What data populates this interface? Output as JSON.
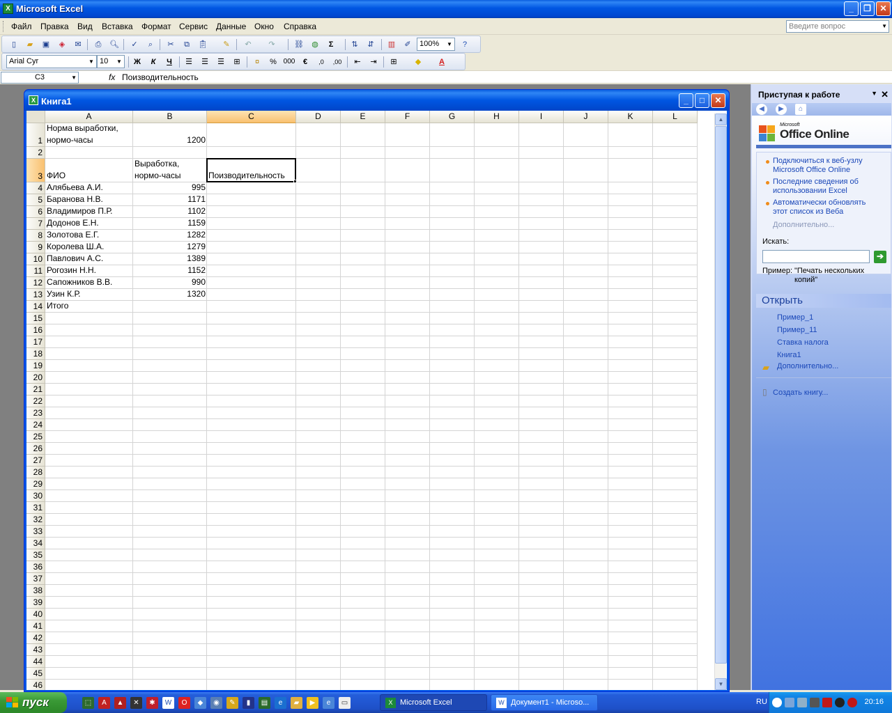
{
  "app": {
    "title": "Microsoft Excel",
    "help_placeholder": "Введите вопрос"
  },
  "menu": [
    "Файл",
    "Правка",
    "Вид",
    "Вставка",
    "Формат",
    "Сервис",
    "Данные",
    "Окно",
    "Справка"
  ],
  "toolbar": {
    "zoom": "100%",
    "font_name": "Arial Cyr",
    "font_size": "10",
    "bold": "Ж",
    "italic": "К",
    "underline": "Ч",
    "percent": "%",
    "thousands": "000",
    "euro": "€",
    "sum": "Σ"
  },
  "formula_bar": {
    "name_box": "C3",
    "fx": "fx",
    "content": "Поизводительность"
  },
  "workbook": {
    "title": "Книга1",
    "columns": [
      "A",
      "B",
      "C",
      "D",
      "E",
      "F",
      "G",
      "H",
      "I",
      "J",
      "K",
      "L"
    ],
    "selected_column": "C",
    "selected_row": "3",
    "rows": [
      "1",
      "2",
      "3",
      "4",
      "5",
      "6",
      "7",
      "8",
      "9",
      "10",
      "11",
      "12",
      "13",
      "14",
      "15",
      "16",
      "17",
      "18",
      "19",
      "20",
      "21",
      "22",
      "23",
      "24",
      "25",
      "26",
      "27",
      "28",
      "29",
      "30",
      "31",
      "32",
      "33",
      "34",
      "35",
      "36",
      "37",
      "38",
      "39",
      "40",
      "41",
      "42",
      "43",
      "44",
      "45",
      "46"
    ],
    "cells": {
      "A1": "Норма выработки, нормо-часы",
      "B1": "1200",
      "A3": "ФИО",
      "B3": "Выработка, нормо-часы",
      "C3": "Поизводительность",
      "A4": "Алябьева А.И.",
      "B4": "995",
      "A5": "Баранова Н.В.",
      "B5": "1171",
      "A6": "Владимиров П.Р.",
      "B6": "1102",
      "A7": "Додонов Е.Н.",
      "B7": "1159",
      "A8": "Золотова Е.Г.",
      "B8": "1282",
      "A9": "Королева Ш.А.",
      "B9": "1279",
      "A10": "Павлович А.С.",
      "B10": "1389",
      "A11": "Рогозин Н.Н.",
      "B11": "1152",
      "A12": "Сапожников В.В.",
      "B12": "990",
      "A13": "Узин К.Р.",
      "B13": "1320",
      "A14": "Итого"
    }
  },
  "task_pane": {
    "title": "Приступая к работе",
    "brand_small": "Microsoft",
    "brand": "Office Online",
    "links": [
      "Подключиться к веб-узлу Microsoft Office Online",
      "Последние сведения об использовании Excel",
      "Автоматически обновлять этот список из Веба"
    ],
    "more_link": "Дополнительно...",
    "search_label": "Искать:",
    "example_label": "Пример:",
    "example_text": "\"Печать нескольких копий\"",
    "open_heading": "Открыть",
    "open_files": [
      "Пример_1",
      "Пример_11",
      "Ставка налога",
      "Книга1"
    ],
    "open_more": "Дополнительно...",
    "create_book": "Создать книгу..."
  },
  "taskbar": {
    "start_label": "пуск",
    "tasks": [
      "Microsoft Excel",
      "Документ1 - Microso..."
    ],
    "language": "RU",
    "clock": "20:16"
  },
  "colors": {
    "xp_blue": "#0055e5",
    "selection_header": "#f9c06f",
    "task_pane_link": "#1a47b8",
    "start_green": "#3a9a36"
  }
}
